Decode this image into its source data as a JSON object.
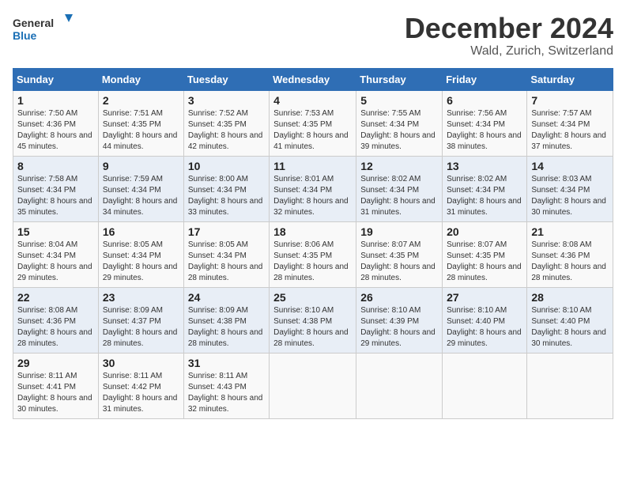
{
  "logo": {
    "text_general": "General",
    "text_blue": "Blue"
  },
  "header": {
    "month": "December 2024",
    "location": "Wald, Zurich, Switzerland"
  },
  "weekdays": [
    "Sunday",
    "Monday",
    "Tuesday",
    "Wednesday",
    "Thursday",
    "Friday",
    "Saturday"
  ],
  "weeks": [
    [
      {
        "day": "1",
        "sunrise": "Sunrise: 7:50 AM",
        "sunset": "Sunset: 4:36 PM",
        "daylight": "Daylight: 8 hours and 45 minutes."
      },
      {
        "day": "2",
        "sunrise": "Sunrise: 7:51 AM",
        "sunset": "Sunset: 4:35 PM",
        "daylight": "Daylight: 8 hours and 44 minutes."
      },
      {
        "day": "3",
        "sunrise": "Sunrise: 7:52 AM",
        "sunset": "Sunset: 4:35 PM",
        "daylight": "Daylight: 8 hours and 42 minutes."
      },
      {
        "day": "4",
        "sunrise": "Sunrise: 7:53 AM",
        "sunset": "Sunset: 4:35 PM",
        "daylight": "Daylight: 8 hours and 41 minutes."
      },
      {
        "day": "5",
        "sunrise": "Sunrise: 7:55 AM",
        "sunset": "Sunset: 4:34 PM",
        "daylight": "Daylight: 8 hours and 39 minutes."
      },
      {
        "day": "6",
        "sunrise": "Sunrise: 7:56 AM",
        "sunset": "Sunset: 4:34 PM",
        "daylight": "Daylight: 8 hours and 38 minutes."
      },
      {
        "day": "7",
        "sunrise": "Sunrise: 7:57 AM",
        "sunset": "Sunset: 4:34 PM",
        "daylight": "Daylight: 8 hours and 37 minutes."
      }
    ],
    [
      {
        "day": "8",
        "sunrise": "Sunrise: 7:58 AM",
        "sunset": "Sunset: 4:34 PM",
        "daylight": "Daylight: 8 hours and 35 minutes."
      },
      {
        "day": "9",
        "sunrise": "Sunrise: 7:59 AM",
        "sunset": "Sunset: 4:34 PM",
        "daylight": "Daylight: 8 hours and 34 minutes."
      },
      {
        "day": "10",
        "sunrise": "Sunrise: 8:00 AM",
        "sunset": "Sunset: 4:34 PM",
        "daylight": "Daylight: 8 hours and 33 minutes."
      },
      {
        "day": "11",
        "sunrise": "Sunrise: 8:01 AM",
        "sunset": "Sunset: 4:34 PM",
        "daylight": "Daylight: 8 hours and 32 minutes."
      },
      {
        "day": "12",
        "sunrise": "Sunrise: 8:02 AM",
        "sunset": "Sunset: 4:34 PM",
        "daylight": "Daylight: 8 hours and 31 minutes."
      },
      {
        "day": "13",
        "sunrise": "Sunrise: 8:02 AM",
        "sunset": "Sunset: 4:34 PM",
        "daylight": "Daylight: 8 hours and 31 minutes."
      },
      {
        "day": "14",
        "sunrise": "Sunrise: 8:03 AM",
        "sunset": "Sunset: 4:34 PM",
        "daylight": "Daylight: 8 hours and 30 minutes."
      }
    ],
    [
      {
        "day": "15",
        "sunrise": "Sunrise: 8:04 AM",
        "sunset": "Sunset: 4:34 PM",
        "daylight": "Daylight: 8 hours and 29 minutes."
      },
      {
        "day": "16",
        "sunrise": "Sunrise: 8:05 AM",
        "sunset": "Sunset: 4:34 PM",
        "daylight": "Daylight: 8 hours and 29 minutes."
      },
      {
        "day": "17",
        "sunrise": "Sunrise: 8:05 AM",
        "sunset": "Sunset: 4:34 PM",
        "daylight": "Daylight: 8 hours and 28 minutes."
      },
      {
        "day": "18",
        "sunrise": "Sunrise: 8:06 AM",
        "sunset": "Sunset: 4:35 PM",
        "daylight": "Daylight: 8 hours and 28 minutes."
      },
      {
        "day": "19",
        "sunrise": "Sunrise: 8:07 AM",
        "sunset": "Sunset: 4:35 PM",
        "daylight": "Daylight: 8 hours and 28 minutes."
      },
      {
        "day": "20",
        "sunrise": "Sunrise: 8:07 AM",
        "sunset": "Sunset: 4:35 PM",
        "daylight": "Daylight: 8 hours and 28 minutes."
      },
      {
        "day": "21",
        "sunrise": "Sunrise: 8:08 AM",
        "sunset": "Sunset: 4:36 PM",
        "daylight": "Daylight: 8 hours and 28 minutes."
      }
    ],
    [
      {
        "day": "22",
        "sunrise": "Sunrise: 8:08 AM",
        "sunset": "Sunset: 4:36 PM",
        "daylight": "Daylight: 8 hours and 28 minutes."
      },
      {
        "day": "23",
        "sunrise": "Sunrise: 8:09 AM",
        "sunset": "Sunset: 4:37 PM",
        "daylight": "Daylight: 8 hours and 28 minutes."
      },
      {
        "day": "24",
        "sunrise": "Sunrise: 8:09 AM",
        "sunset": "Sunset: 4:38 PM",
        "daylight": "Daylight: 8 hours and 28 minutes."
      },
      {
        "day": "25",
        "sunrise": "Sunrise: 8:10 AM",
        "sunset": "Sunset: 4:38 PM",
        "daylight": "Daylight: 8 hours and 28 minutes."
      },
      {
        "day": "26",
        "sunrise": "Sunrise: 8:10 AM",
        "sunset": "Sunset: 4:39 PM",
        "daylight": "Daylight: 8 hours and 29 minutes."
      },
      {
        "day": "27",
        "sunrise": "Sunrise: 8:10 AM",
        "sunset": "Sunset: 4:40 PM",
        "daylight": "Daylight: 8 hours and 29 minutes."
      },
      {
        "day": "28",
        "sunrise": "Sunrise: 8:10 AM",
        "sunset": "Sunset: 4:40 PM",
        "daylight": "Daylight: 8 hours and 30 minutes."
      }
    ],
    [
      {
        "day": "29",
        "sunrise": "Sunrise: 8:11 AM",
        "sunset": "Sunset: 4:41 PM",
        "daylight": "Daylight: 8 hours and 30 minutes."
      },
      {
        "day": "30",
        "sunrise": "Sunrise: 8:11 AM",
        "sunset": "Sunset: 4:42 PM",
        "daylight": "Daylight: 8 hours and 31 minutes."
      },
      {
        "day": "31",
        "sunrise": "Sunrise: 8:11 AM",
        "sunset": "Sunset: 4:43 PM",
        "daylight": "Daylight: 8 hours and 32 minutes."
      },
      null,
      null,
      null,
      null
    ]
  ]
}
